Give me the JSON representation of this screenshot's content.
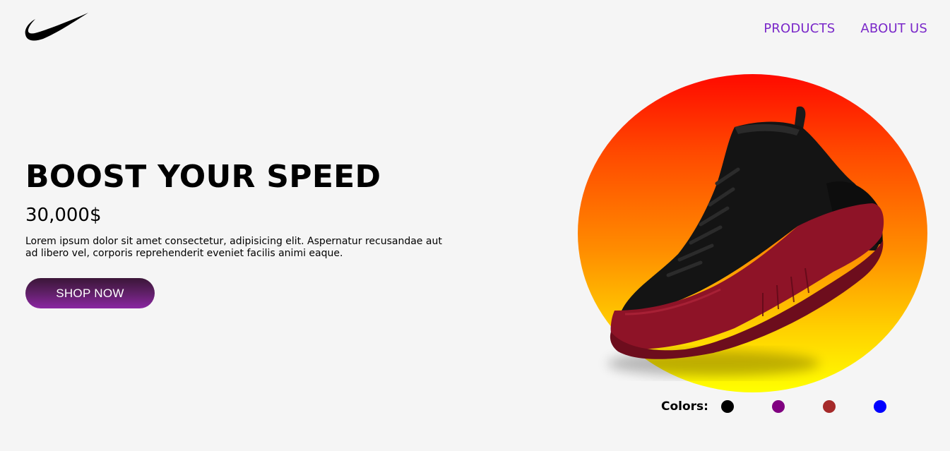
{
  "header": {
    "logo": "nike-swoosh-logo",
    "nav": [
      {
        "label": "PRODUCTS"
      },
      {
        "label": "ABOUT US"
      }
    ],
    "nav_color": "#7a28c9"
  },
  "hero": {
    "title": "BOOST YOUR SPEED",
    "price": "30,000$",
    "description": "Lorem ipsum dolor sit amet consectetur, adipisicing elit. Aspernatur recusandae aut ad libero vel, corporis reprehenderit eveniet facilis animi eaque.",
    "button_label": "SHOP NOW"
  },
  "product_image": {
    "icon": "sneaker-image",
    "gradient": [
      "#ff0a00",
      "#ffff00"
    ]
  },
  "colors": {
    "label": "Colors:",
    "swatches": [
      "#000000",
      "#800080",
      "#a52a2a",
      "#0000ff"
    ]
  }
}
